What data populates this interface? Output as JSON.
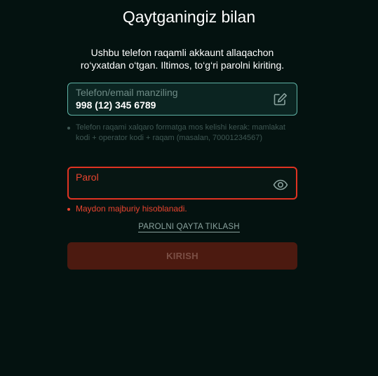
{
  "page": {
    "title": "Qaytganingiz bilan",
    "subtitle": "Ushbu telefon raqamli akkaunt allaqachon ro‘yxatdan o‘tgan. Iltimos, to‘g‘ri parolni kiriting."
  },
  "phone_field": {
    "label": "Telefon/email manziling",
    "value": "998 (12) 345 6789",
    "icon": "edit-icon",
    "hint": "Telefon raqami xalqaro formatga mos kelishi kerak: mamlakat kodi + operator kodi + raqam (masalan, 70001234567)"
  },
  "password_field": {
    "label": "Parol",
    "value": "",
    "icon": "eye-icon",
    "error": "Maydon majburiy hisoblanadi."
  },
  "reset_link": "PAROLNI QAYTA TIKLASH",
  "submit_button": "KIRISH",
  "colors": {
    "background": "#041210",
    "accent_border": "#5fb3a6",
    "error": "#e8442f",
    "button_bg": "#4c1a10",
    "button_text": "#7b4f45"
  }
}
